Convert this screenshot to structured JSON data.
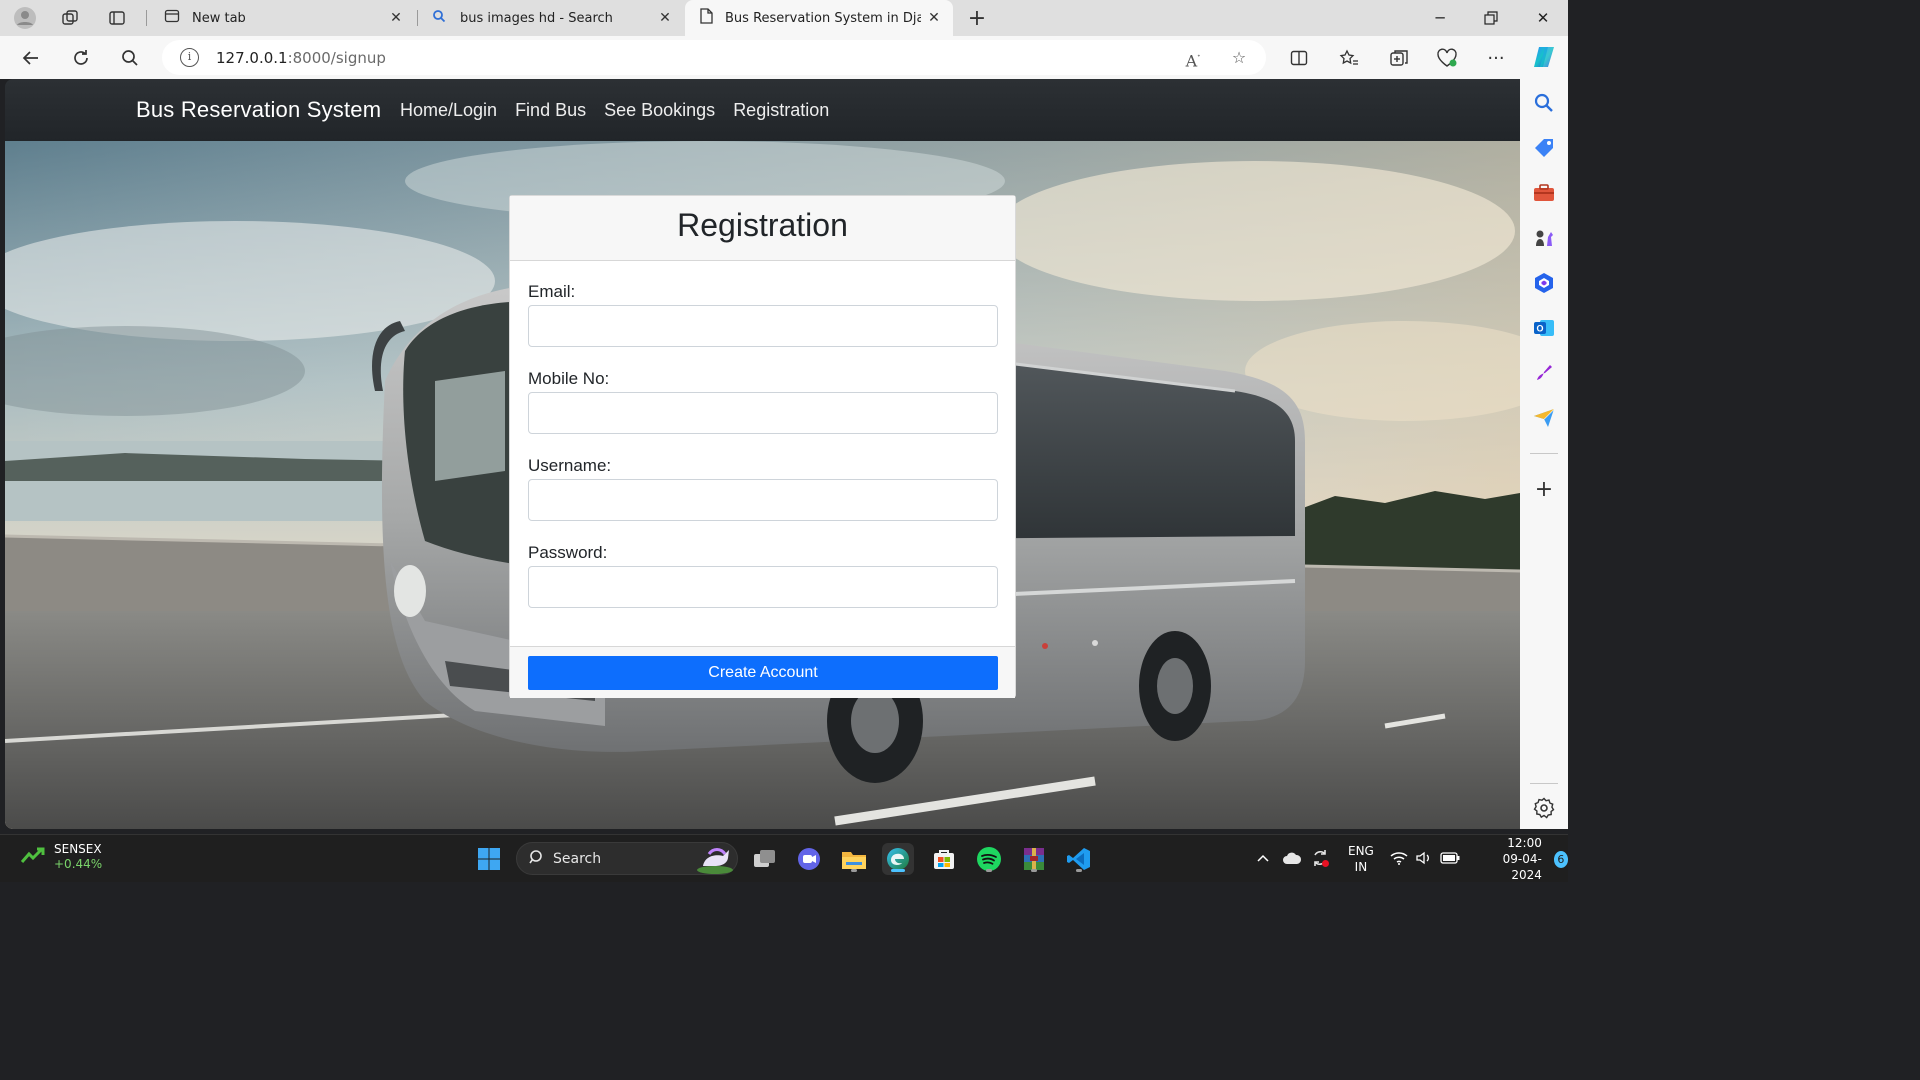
{
  "browser": {
    "tabs": [
      {
        "title": "New tab"
      },
      {
        "title": "bus images hd - Search"
      },
      {
        "title": "Bus Reservation System in Djang",
        "active": true
      }
    ],
    "address": {
      "host": "127.0.0.1",
      "path": ":8000/signup"
    }
  },
  "site": {
    "brand": "Bus Reservation System",
    "nav": [
      {
        "label": "Home/Login"
      },
      {
        "label": "Find Bus"
      },
      {
        "label": "See Bookings"
      },
      {
        "label": "Registration"
      }
    ]
  },
  "form": {
    "title": "Registration",
    "fields": [
      {
        "label": "Email:",
        "value": ""
      },
      {
        "label": "Mobile No:",
        "value": ""
      },
      {
        "label": "Username:",
        "value": ""
      },
      {
        "label": "Password:",
        "value": ""
      }
    ],
    "submit_label": "Create Account"
  },
  "taskbar": {
    "widget": {
      "ticker": "SENSEX",
      "change": "+0.44%"
    },
    "search_label": "Search",
    "tray": {
      "language": "ENG",
      "region": "IN",
      "time": "12:00",
      "date": "09-04-2024",
      "notification_count": "6"
    }
  },
  "colors": {
    "navbar": "#212529",
    "primary_button": "#0d6efd",
    "card_header": "#f7f7f7"
  }
}
